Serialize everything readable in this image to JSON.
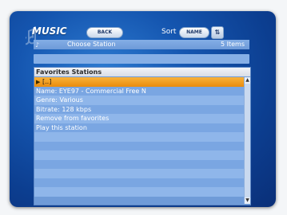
{
  "app": {
    "title": "MUSIC",
    "back_label": "BACK",
    "sort_label": "Sort",
    "sort_value": "NAME",
    "sort_direction_icon": "sort-arrows-icon"
  },
  "header": {
    "title": "Choose Station",
    "count": "5 Items"
  },
  "list": {
    "title": "Favorites Stations",
    "selected_index": 0,
    "items": [
      {
        "label": "[..]"
      },
      {
        "label": "Name: EYE97 - Commercial Free N"
      },
      {
        "label": "Genre: Various"
      },
      {
        "label": "Bitrate: 128 kbps"
      },
      {
        "label": "Remove from favorites"
      },
      {
        "label": "Play this station"
      },
      {
        "label": ""
      },
      {
        "label": ""
      },
      {
        "label": ""
      },
      {
        "label": ""
      },
      {
        "label": ""
      },
      {
        "label": ""
      },
      {
        "label": ""
      }
    ]
  },
  "colors": {
    "background": "#1556b0",
    "selection": "#f0a020",
    "row_light": "#8fb6ea",
    "row_dark": "#7aa6e2"
  }
}
